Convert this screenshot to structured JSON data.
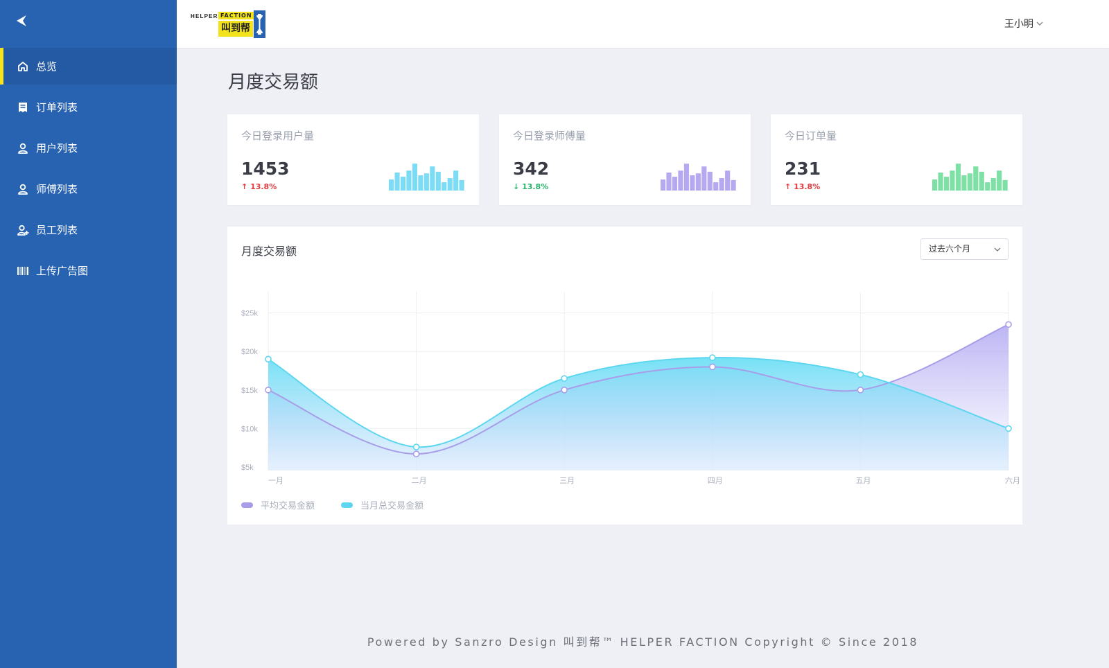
{
  "app": {
    "logo": {
      "top_text": "HELPER",
      "faction_text": "FACTION",
      "cn_text": "叫到帮"
    },
    "user_name": "王小明"
  },
  "sidebar": {
    "items": [
      {
        "label": "总览",
        "icon": "home-icon",
        "active": true
      },
      {
        "label": "订单列表",
        "icon": "receipt-icon",
        "active": false
      },
      {
        "label": "用户列表",
        "icon": "user-icon",
        "active": false
      },
      {
        "label": "师傅列表",
        "icon": "user-icon",
        "active": false
      },
      {
        "label": "员工列表",
        "icon": "user-add-icon",
        "active": false
      },
      {
        "label": "上传广告图",
        "icon": "barcode-icon",
        "active": false
      }
    ]
  },
  "page": {
    "title": "月度交易额"
  },
  "stats": [
    {
      "label": "今日登录用户量",
      "value": "1453",
      "change": "13.8%",
      "direction": "up",
      "color": "#7ddcf5",
      "bars": [
        0.4,
        0.65,
        0.5,
        0.72,
        0.97,
        0.55,
        0.62,
        0.87,
        0.68,
        0.3,
        0.45,
        0.72,
        0.38
      ]
    },
    {
      "label": "今日登录师傅量",
      "value": "342",
      "change": "13.8%",
      "direction": "down",
      "color": "#b7a9ef",
      "bars": [
        0.4,
        0.65,
        0.5,
        0.72,
        0.97,
        0.55,
        0.62,
        0.87,
        0.68,
        0.3,
        0.45,
        0.72,
        0.38
      ]
    },
    {
      "label": "今日订单量",
      "value": "231",
      "change": "13.8%",
      "direction": "up",
      "color": "#7ee0a4",
      "bars": [
        0.4,
        0.65,
        0.5,
        0.72,
        0.97,
        0.55,
        0.62,
        0.87,
        0.68,
        0.3,
        0.45,
        0.72,
        0.38
      ]
    }
  ],
  "chart_panel": {
    "title": "月度交易额",
    "range_select": "过去六个月"
  },
  "chart_data": {
    "type": "area",
    "categories": [
      "一月",
      "二月",
      "三月",
      "四月",
      "五月",
      "六月"
    ],
    "series": [
      {
        "name": "平均交易金额",
        "values": [
          15000,
          6700,
          15000,
          18000,
          15000,
          23500
        ],
        "color": "#a99de9"
      },
      {
        "name": "当月总交易金额",
        "values": [
          19000,
          7600,
          16500,
          19200,
          17000,
          10000
        ],
        "color": "#5dd6ef"
      }
    ],
    "y_ticks": [
      "$5k",
      "$10k",
      "$15k",
      "$20k",
      "$25k"
    ],
    "ylim": [
      5000,
      25000
    ],
    "grid": true,
    "legend_position": "bottom-left"
  },
  "footer": {
    "text": "Powered by Sanzro Design 叫到帮™ HELPER FACTION Copyright © Since 2018"
  }
}
